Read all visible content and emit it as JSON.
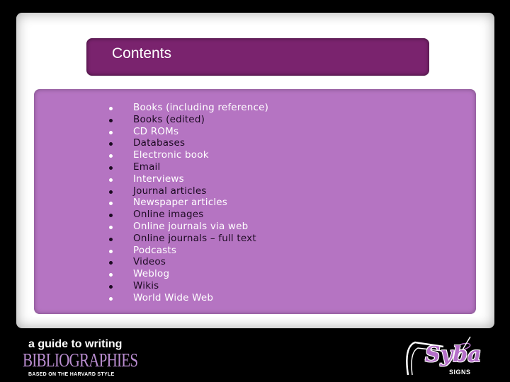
{
  "slide": {
    "title": "Contents",
    "items": [
      {
        "label": "Books (including reference)",
        "tone": "light"
      },
      {
        "label": "Books (edited)",
        "tone": "dark"
      },
      {
        "label": "CD ROMs",
        "tone": "light"
      },
      {
        "label": "Databases",
        "tone": "dark"
      },
      {
        "label": "Electronic book",
        "tone": "light"
      },
      {
        "label": "Email",
        "tone": "dark"
      },
      {
        "label": "Interviews",
        "tone": "light"
      },
      {
        "label": "Journal articles",
        "tone": "dark"
      },
      {
        "label": "Newspaper articles",
        "tone": "light"
      },
      {
        "label": "Online images",
        "tone": "dark"
      },
      {
        "label": "Online journals via web",
        "tone": "light"
      },
      {
        "label": "Online journals – full text",
        "tone": "dark"
      },
      {
        "label": "Podcasts",
        "tone": "light"
      },
      {
        "label": "Videos",
        "tone": "dark"
      },
      {
        "label": "Weblog",
        "tone": "light"
      },
      {
        "label": "Wikis",
        "tone": "dark"
      },
      {
        "label": "World Wide Web",
        "tone": "light"
      }
    ]
  },
  "footer": {
    "guide_line": "a guide to writing",
    "brand_title": "BIBLIOGRAPHIES",
    "subtitle": "BASED ON THE HARVARD STYLE",
    "logo_name": "Syba",
    "logo_sub": "SIGNS"
  },
  "colors": {
    "title_bar": "#7a236e",
    "content_box": "#b574c2",
    "text_light": "#ffffff",
    "text_dark": "#1c0a22",
    "brand_purple": "#b98ccf"
  }
}
